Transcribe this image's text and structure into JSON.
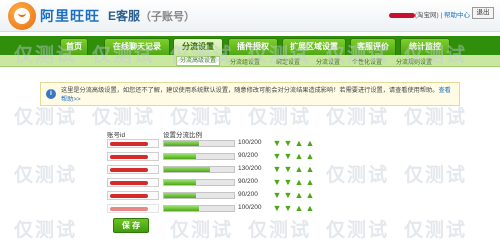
{
  "header": {
    "brand": "阿里旺旺",
    "product": "E客服",
    "product_suffix": "（子账号）",
    "store": "(淘宝网)",
    "separator": "|",
    "help": "帮助中心",
    "exit": "退出"
  },
  "nav": {
    "tabs": [
      {
        "label": "首页",
        "active": false
      },
      {
        "label": "在线聊天记录",
        "active": false
      },
      {
        "label": "分流设置",
        "active": true
      },
      {
        "label": "插件授权",
        "active": false
      },
      {
        "label": "扩展区域设置",
        "active": false
      },
      {
        "label": "客服评价",
        "active": false
      },
      {
        "label": "统计监控",
        "active": false
      }
    ]
  },
  "subnav": {
    "items": [
      {
        "label": "分流高级设置",
        "active": true
      },
      {
        "label": "分流组设置",
        "active": false
      },
      {
        "label": "绑定设置",
        "active": false
      },
      {
        "label": "分流设置",
        "active": false
      },
      {
        "label": "个性化设置",
        "active": false
      },
      {
        "label": "分流规则设置",
        "active": false
      }
    ]
  },
  "info": {
    "icon": "i",
    "text": "这里是分流高级设置，如您还不了解，建议使用系统默认设置，随意修改可能会对分流结果造成影响！若需要进行设置，请查看使用帮助。",
    "link": "查看帮助>>"
  },
  "table": {
    "header_account": "账号id",
    "header_ratio": "设置分流比例",
    "rows": [
      {
        "value": "100/200",
        "fill": 0.5
      },
      {
        "value": "90/200",
        "fill": 0.45
      },
      {
        "value": "130/200",
        "fill": 0.65
      },
      {
        "value": "90/200",
        "fill": 0.45
      },
      {
        "value": "90/200",
        "fill": 0.45
      },
      {
        "value": "100/200",
        "fill": 0.5
      }
    ]
  },
  "save_label": "保 存",
  "watermark": "仅测试",
  "colors": {
    "nav_green": "#2f8f0a",
    "tab_green": "#7fcf2a",
    "brand_blue": "#1a6fc4",
    "redact_red": "#c8102e"
  },
  "icons": [
    "logo-icon",
    "info-icon",
    "arrow-up-icon",
    "arrow-down-icon"
  ]
}
